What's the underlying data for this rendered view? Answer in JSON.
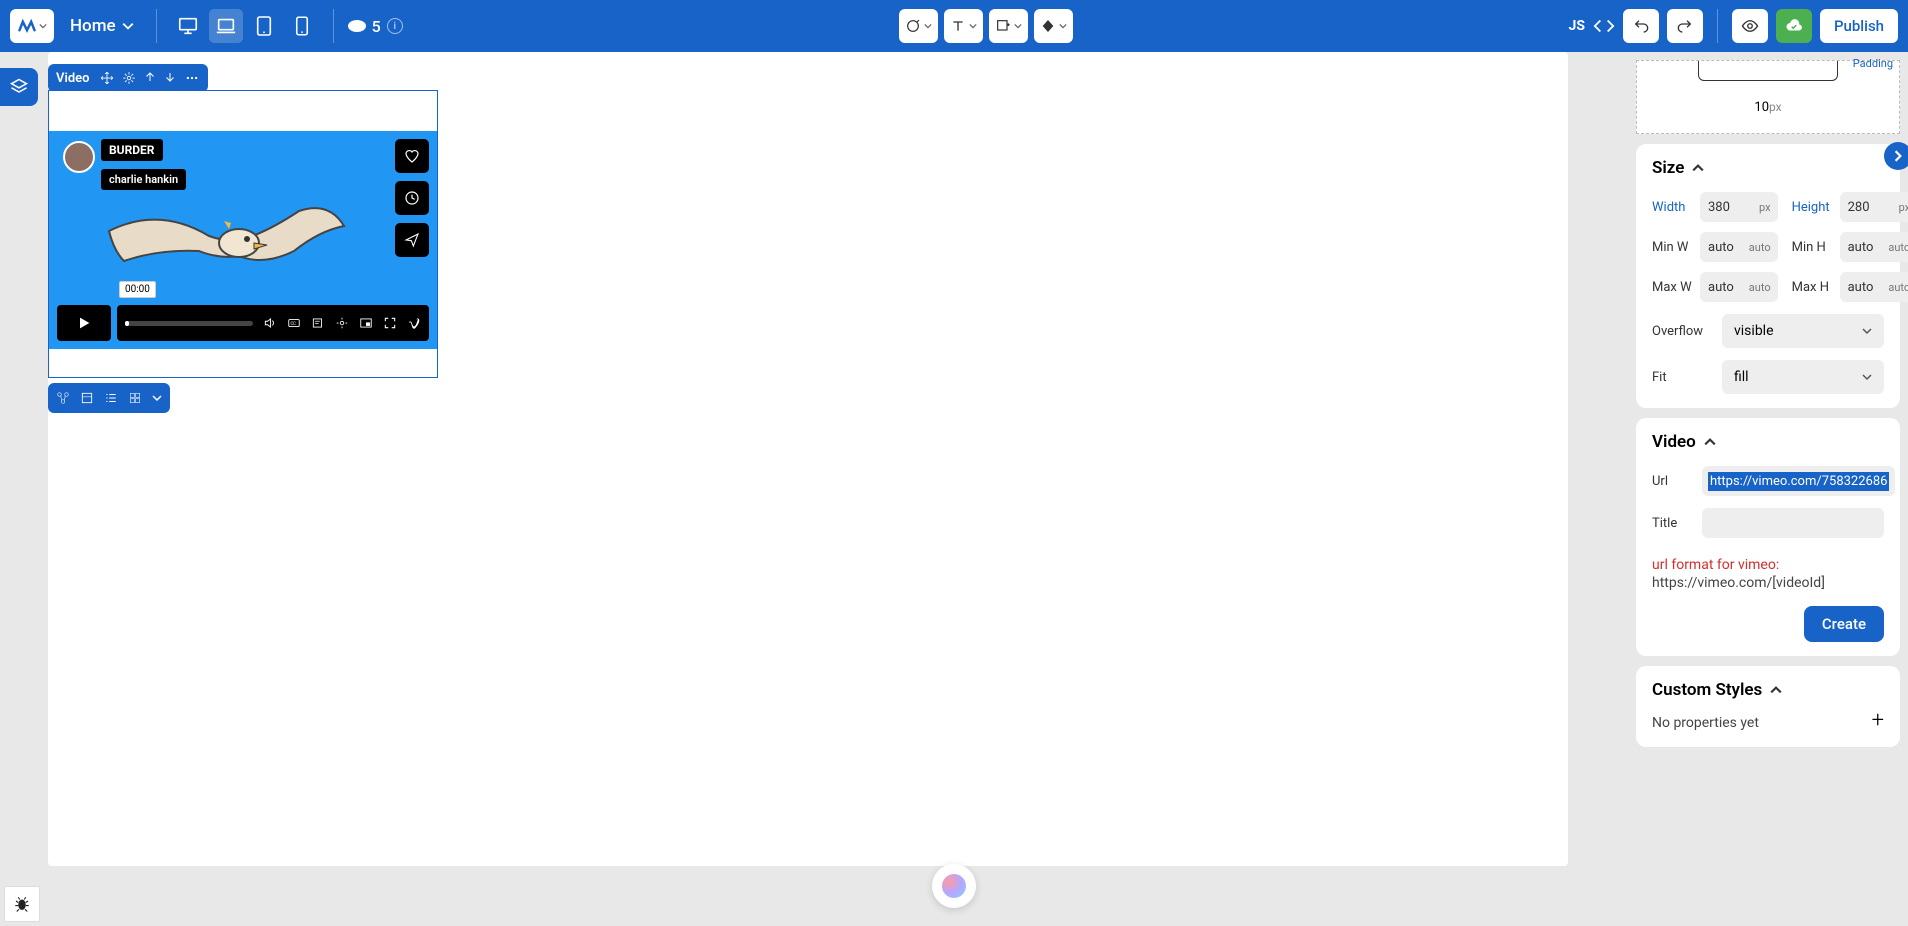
{
  "toolbar": {
    "page_name": "Home",
    "credits": "5",
    "js_label": "JS",
    "publish_label": "Publish"
  },
  "selected": {
    "label": "Video"
  },
  "video_preview": {
    "title": "BURDER",
    "author": "charlie hankin",
    "time": "00:00"
  },
  "spacing": {
    "padding_label": "Padding",
    "bottom_value": "10",
    "unit": "px"
  },
  "size": {
    "title": "Size",
    "width_label": "Width",
    "width_value": "380",
    "width_unit": "px",
    "height_label": "Height",
    "height_value": "280",
    "height_unit": "px",
    "minw_label": "Min W",
    "minw_value": "auto",
    "minw_unit": "auto",
    "minh_label": "Min H",
    "minh_value": "auto",
    "minh_unit": "auto",
    "maxw_label": "Max W",
    "maxw_value": "auto",
    "maxw_unit": "auto",
    "maxh_label": "Max H",
    "maxh_value": "auto",
    "maxh_unit": "auto",
    "overflow_label": "Overflow",
    "overflow_value": "visible",
    "fit_label": "Fit",
    "fit_value": "fill"
  },
  "video": {
    "title": "Video",
    "url_label": "Url",
    "url_value": "https://vimeo.com/758322686",
    "title_label": "Title",
    "hint_red": "url format for vimeo:",
    "hint_gray": "https://vimeo.com/[videoId]",
    "create_label": "Create"
  },
  "custom_styles": {
    "title": "Custom Styles",
    "no_props": "No properties yet"
  }
}
